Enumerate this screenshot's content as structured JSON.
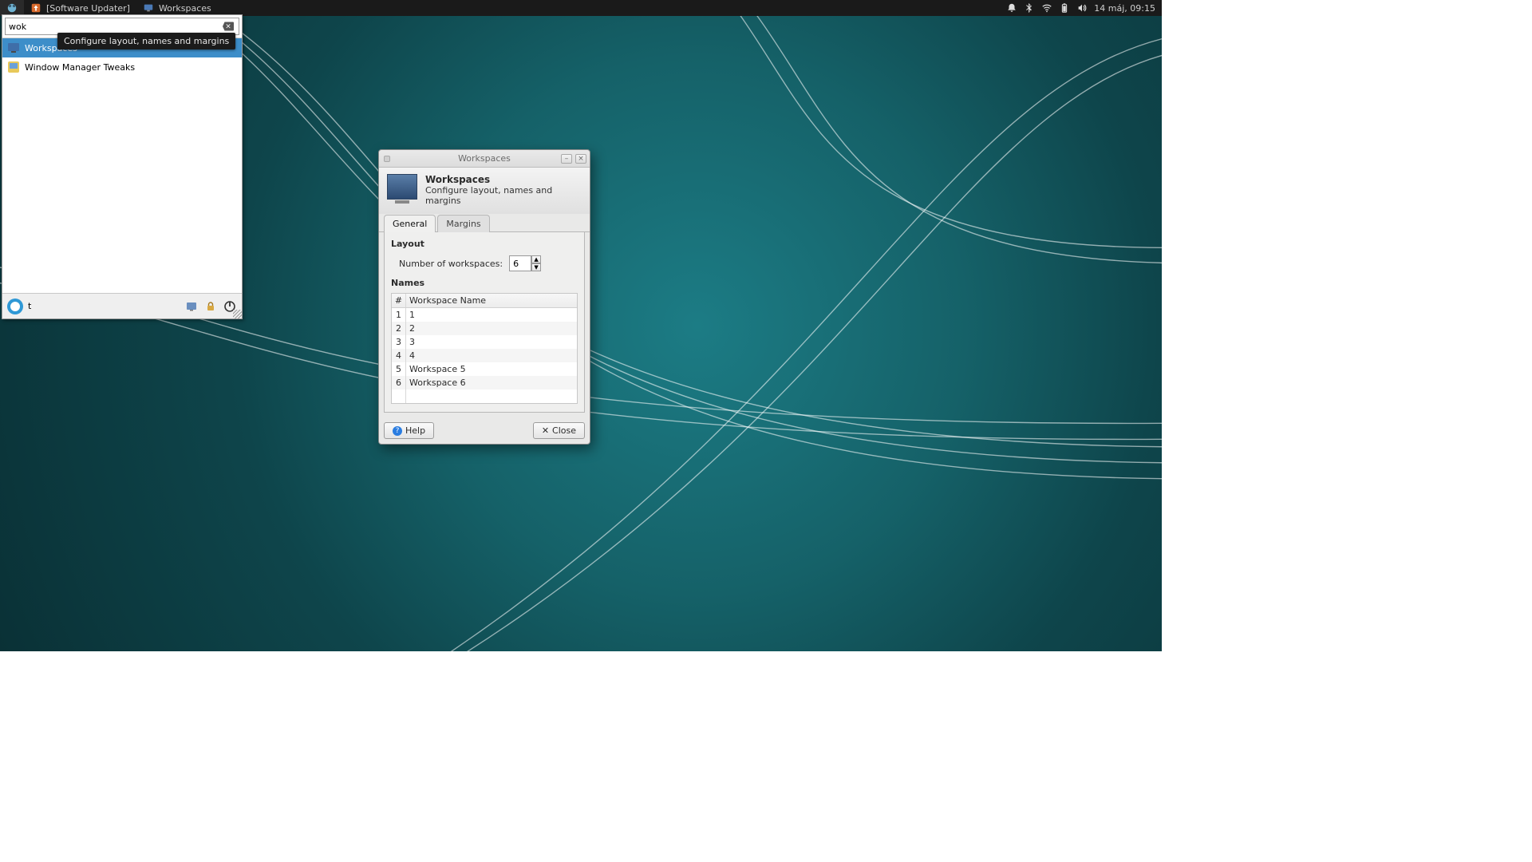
{
  "panel": {
    "taskbar": [
      {
        "label": "[Software Updater]",
        "icon": "updater-icon"
      },
      {
        "label": "Workspaces",
        "icon": "workspaces-icon"
      }
    ],
    "clock": "14 máj, 09:15"
  },
  "menu": {
    "search_value": "wok",
    "tooltip": "Configure layout, names and margins",
    "items": [
      {
        "label": "Workspaces",
        "selected": true
      },
      {
        "label": "Window Manager Tweaks",
        "selected": false
      }
    ],
    "username": "t"
  },
  "dialog": {
    "title": "Workspaces",
    "header_title": "Workspaces",
    "header_sub": "Configure layout, names and margins",
    "tabs": {
      "general": "General",
      "margins": "Margins"
    },
    "layout_label": "Layout",
    "num_label": "Number of workspaces:",
    "num_value": "6",
    "names_label": "Names",
    "col_index": "#",
    "col_name": "Workspace Name",
    "rows": [
      {
        "n": "1",
        "name": "1"
      },
      {
        "n": "2",
        "name": "2"
      },
      {
        "n": "3",
        "name": "3"
      },
      {
        "n": "4",
        "name": "4"
      },
      {
        "n": "5",
        "name": "Workspace 5"
      },
      {
        "n": "6",
        "name": "Workspace 6"
      }
    ],
    "help": "Help",
    "close": "Close"
  }
}
